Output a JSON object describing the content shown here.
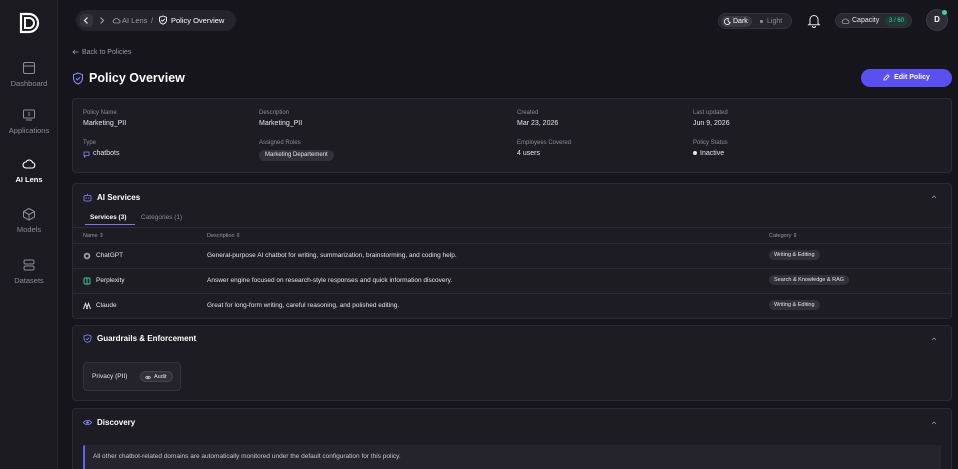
{
  "sidebar": {
    "items": [
      {
        "label": "Dashboard",
        "icon": "dashboard-icon"
      },
      {
        "label": "Applications",
        "icon": "applications-icon"
      },
      {
        "label": "AI Lens",
        "icon": "cloud-icon"
      },
      {
        "label": "Models",
        "icon": "cube-icon"
      },
      {
        "label": "Datasets",
        "icon": "datasets-icon"
      }
    ]
  },
  "breadcrumb": {
    "parent": "AI Lens",
    "separator": "/",
    "current": "Policy Overview"
  },
  "theme": {
    "dark": "Dark",
    "light": "Light"
  },
  "capacity": {
    "label": "Capacity",
    "value": "3 / 60"
  },
  "avatar": {
    "initial": "D"
  },
  "page": {
    "back_label": "Back to Policies",
    "title": "Policy Overview",
    "edit_label": "Edit Policy"
  },
  "policy": {
    "name_label": "Policy Name",
    "name": "Marketing_PII",
    "description_label": "Description",
    "description": "Marketing_PII",
    "created_label": "Created",
    "created": "Mar 23, 2026",
    "updated_label": "Last updated",
    "updated": "Jun 9, 2026",
    "type_label": "Type",
    "type": "chatbots",
    "roles_label": "Assigned Roles",
    "role": "Marketing Departement",
    "employees_label": "Employees Covered",
    "employees": "4 users",
    "status_label": "Policy Status",
    "status": "Inactive"
  },
  "ai_services": {
    "title": "AI Services",
    "tabs": [
      "Services (3)",
      "Categories (1)"
    ],
    "columns": [
      "Name ⇕",
      "Description ⇕",
      "Category ⇕"
    ],
    "rows": [
      {
        "name": "ChatGPT",
        "description": "General-purpose AI chatbot for writing, summarization, brainstorming, and coding help.",
        "category": "Writing & Editing"
      },
      {
        "name": "Perplexity",
        "description": "Answer engine focused on research-style responses and quick information discovery.",
        "category": "Search & Knowledge & RAG"
      },
      {
        "name": "Claude",
        "description": "Great for long-form writing, careful reasoning, and polished editing.",
        "category": "Writing & Editing"
      }
    ]
  },
  "guardrails": {
    "title": "Guardrails & Enforcement",
    "item_label": "Privacy (PII)",
    "mode": "Audit"
  },
  "discovery": {
    "title": "Discovery",
    "notice": "All other chatbot-related domains are automatically monitored under the default configuration for this policy."
  },
  "colors": {
    "accent": "#5a4ff0",
    "background": "#16151c",
    "card": "#1d1c23",
    "success": "#3fd1a6"
  }
}
